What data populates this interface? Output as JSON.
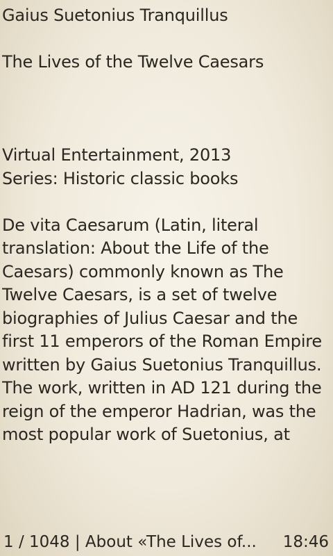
{
  "book": {
    "author": "Gaius Suetonius Tranquillus",
    "title": "The Lives of the Twelve Caesars",
    "publisher": "Virtual Entertainment, 2013",
    "series": "Series: Historic classic books",
    "description_lines": [
      "De vita Caesarum (Latin, literal",
      "translation: About the Life of the",
      "Caesars) commonly known as The",
      "Twelve Caesars, is a set of twelve",
      "biographies of Julius Caesar and the",
      "first 11 emperors of the Roman Empire",
      "written by Gaius Suetonius Tranquillus.",
      "The work, written in AD 121 during the",
      "reign of the emperor Hadrian, was the",
      "most popular work of Suetonius, at"
    ]
  },
  "status": {
    "position": "1 / 1048 | About «The Lives of...",
    "time": "18:46"
  },
  "colors": {
    "paper": "#efe9dc",
    "text": "#2a2620"
  }
}
